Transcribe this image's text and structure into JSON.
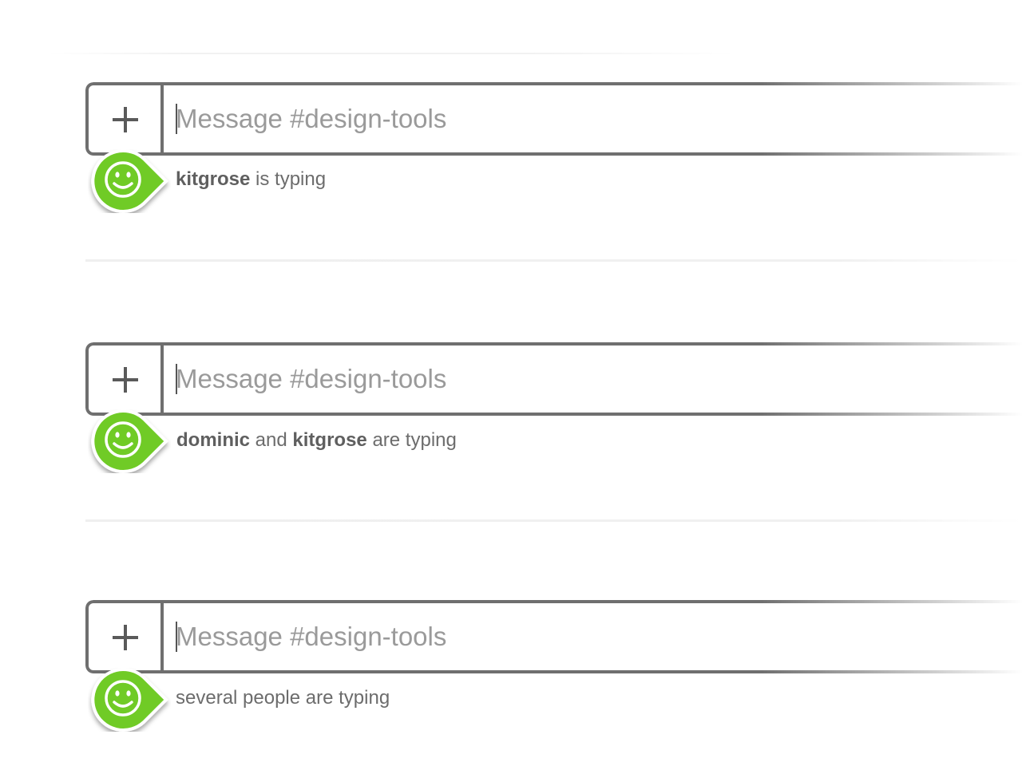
{
  "composers": [
    {
      "placeholder": "Message #design-tools",
      "typing": {
        "user1": "kitgrose",
        "text1": " is typing"
      }
    },
    {
      "placeholder": "Message #design-tools",
      "typing": {
        "user1": "dominic",
        "text1": " and ",
        "user2": "kitgrose",
        "text2": " are typing"
      }
    },
    {
      "placeholder": "Message #design-tools",
      "typing": {
        "text1": "several people are typing"
      }
    }
  ],
  "icons": {
    "attach": "plus-icon",
    "typing_indicator": "smiley-face-icon"
  },
  "colors": {
    "frame": "#6f6f6f",
    "badge_green": "#6fcb26",
    "badge_outline": "#ffffff",
    "placeholder": "#9a9a9a",
    "typing_text": "#6c6c6c"
  }
}
